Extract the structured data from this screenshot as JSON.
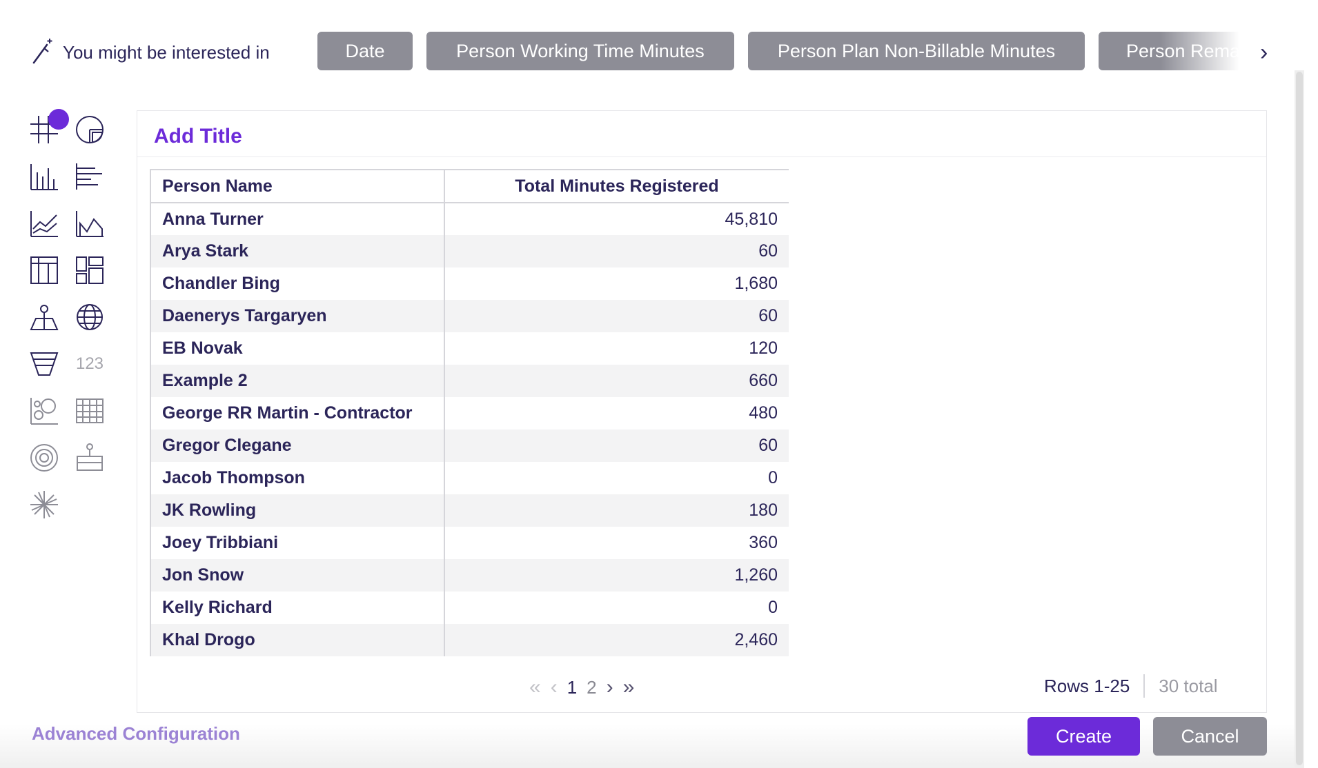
{
  "suggestions": {
    "label": "You might be interested in",
    "chips": [
      "Date",
      "Person Working Time Minutes",
      "Person Plan Non-Billable Minutes",
      "Person Remai"
    ],
    "next_icon": "chevron-right-icon",
    "wand_icon": "magic-wand-icon"
  },
  "visualization_picker": {
    "items": [
      "table-icon",
      "pie-chart-icon",
      "column-chart-icon",
      "bar-chart-icon",
      "line-chart-icon",
      "area-chart-icon",
      "pivot-table-icon",
      "dashboard-layout-icon",
      "map-icon",
      "globe-icon",
      "funnel-icon",
      "number-icon",
      "bubble-chart-icon",
      "heatmap-icon",
      "radial-icon",
      "waterfall-icon",
      "sunburst-icon"
    ],
    "number_label": "123",
    "active": "table-icon",
    "accent": "#6c2bd9"
  },
  "panel": {
    "title": "Add Title",
    "table": {
      "columns": [
        "Person Name",
        "Total Minutes Registered"
      ],
      "rows": [
        [
          "Anna Turner",
          "45,810"
        ],
        [
          "Arya Stark",
          "60"
        ],
        [
          "Chandler Bing",
          "1,680"
        ],
        [
          "Daenerys Targaryen",
          "60"
        ],
        [
          "EB Novak",
          "120"
        ],
        [
          "Example 2",
          "660"
        ],
        [
          "George RR Martin - Contractor",
          "480"
        ],
        [
          "Gregor Clegane",
          "60"
        ],
        [
          "Jacob Thompson",
          "0"
        ],
        [
          "JK Rowling",
          "180"
        ],
        [
          "Joey Tribbiani",
          "360"
        ],
        [
          "Jon Snow",
          "1,260"
        ],
        [
          "Kelly Richard",
          "0"
        ],
        [
          "Khal Drogo",
          "2,460"
        ]
      ]
    },
    "pagination": {
      "pages": [
        "1",
        "2"
      ],
      "current": "1"
    },
    "rows_range": "Rows 1-25",
    "rows_total": "30 total"
  },
  "footer": {
    "advanced_config": "Advanced Configuration",
    "create": "Create",
    "cancel": "Cancel"
  }
}
